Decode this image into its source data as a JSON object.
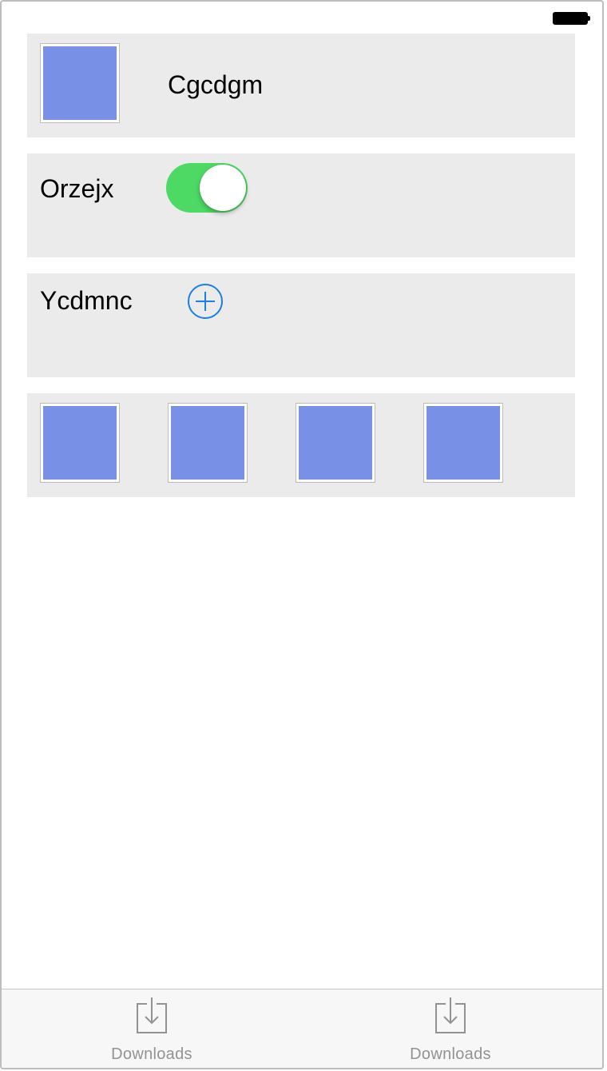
{
  "status_bar": {
    "battery_icon": "battery-icon"
  },
  "rows": {
    "profile": {
      "thumbnail_color": "#7890e5",
      "label": "Cgcdgm"
    },
    "switch": {
      "label": "Orzejx",
      "toggle_on": true,
      "toggle_color": "#4cd964"
    },
    "add": {
      "label": "Ycdmnc",
      "icon": "add-circle-icon",
      "icon_color": "#1a7fe6"
    },
    "gallery": {
      "thumbnail_count": 4,
      "thumbnail_color": "#7890e5"
    }
  },
  "tab_bar": {
    "items": [
      {
        "label": "Downloads",
        "icon": "download-icon"
      },
      {
        "label": "Downloads",
        "icon": "download-icon"
      }
    ]
  }
}
